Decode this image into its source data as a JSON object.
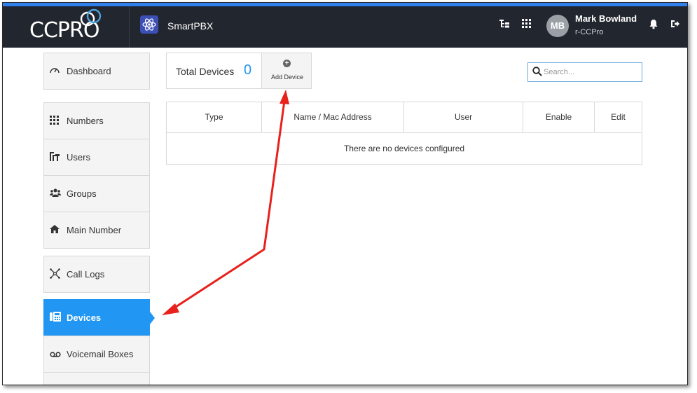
{
  "header": {
    "logo_text": "CCPRO",
    "app_title": "SmartPBX",
    "icons": [
      "hierarchy-icon",
      "apps-grid-icon",
      "bell-icon",
      "logout-icon"
    ],
    "accent_color": "#2f80ed",
    "user": {
      "initials": "MB",
      "name": "Mark Bowland",
      "org": "r-CCPro"
    }
  },
  "sidebar": {
    "items": [
      {
        "label": "Dashboard",
        "icon": "dashboard-icon"
      },
      {
        "label": "Numbers",
        "icon": "grid-icon"
      },
      {
        "label": "Users",
        "icon": "users-icon"
      },
      {
        "label": "Groups",
        "icon": "groups-icon"
      },
      {
        "label": "Main Number",
        "icon": "home-icon"
      },
      {
        "label": "Call Logs",
        "icon": "call-logs-icon"
      },
      {
        "label": "Devices",
        "icon": "devices-icon",
        "active": true
      },
      {
        "label": "Voicemail Boxes",
        "icon": "voicemail-icon"
      }
    ],
    "active_color": "#2196f3"
  },
  "devices": {
    "total_label": "Total Devices",
    "total_count": "0",
    "add_label": "Add Device"
  },
  "search": {
    "placeholder": "Search..."
  },
  "table": {
    "columns": [
      "Type",
      "Name / Mac Address",
      "User",
      "Enable",
      "Edit"
    ],
    "empty_message": "There are no devices configured"
  },
  "annotation": {
    "arrow_color": "#e8211c"
  }
}
